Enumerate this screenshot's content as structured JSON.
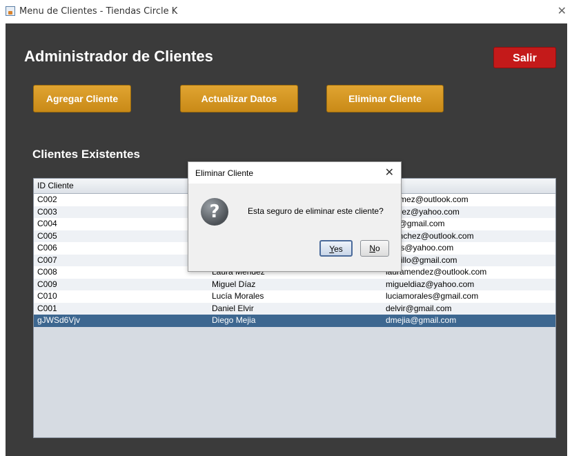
{
  "window": {
    "title": "Menu de Clientes - Tiendas Circle K",
    "close_glyph": "✕"
  },
  "header": {
    "title": "Administrador de Clientes",
    "exit_label": "Salir"
  },
  "toolbar": {
    "add_label": "Agregar Cliente",
    "update_label": "Actualizar Datos",
    "delete_label": "Eliminar Cliente"
  },
  "section": {
    "title": "Clientes Existentes"
  },
  "table": {
    "columns": [
      "ID Cliente",
      "",
      "rreo"
    ],
    "rows": [
      [
        "C002",
        "",
        "agomez@outlook.com"
      ],
      [
        "C003",
        "",
        "amirez@yahoo.com"
      ],
      [
        "C004",
        "",
        "ciaf@gmail.com"
      ],
      [
        "C005",
        "",
        "ssanchez@outlook.com"
      ],
      [
        "C006",
        "",
        "orres@yahoo.com"
      ],
      [
        "C007",
        "",
        "castillo@gmail.com"
      ],
      [
        "C008",
        "Laura Mendez",
        "lauramendez@outlook.com"
      ],
      [
        "C009",
        "Miguel Díaz",
        "migueldiaz@yahoo.com"
      ],
      [
        "C010",
        "Lucía Morales",
        "luciamorales@gmail.com"
      ],
      [
        "C001",
        "Daniel Elvir",
        "delvir@gmail.com"
      ],
      [
        "gJWSd6Vjv",
        "Diego Mejia",
        "dmejia@gmail.com"
      ]
    ],
    "selected_row_index": 10
  },
  "dialog": {
    "title": "Eliminar Cliente",
    "close_glyph": "✕",
    "icon_glyph": "?",
    "message": "Esta seguro de eliminar este cliente?",
    "yes_label": "Yes",
    "no_label": "No"
  },
  "colors": {
    "panel_bg": "#3b3b3b",
    "exit_button": "#c41a1a",
    "action_button": "#d39522",
    "selection": "#3d6790",
    "table_bg": "#d6dbe2"
  },
  "icons": {
    "app": "java-cup-icon",
    "dialog": "question-icon"
  }
}
